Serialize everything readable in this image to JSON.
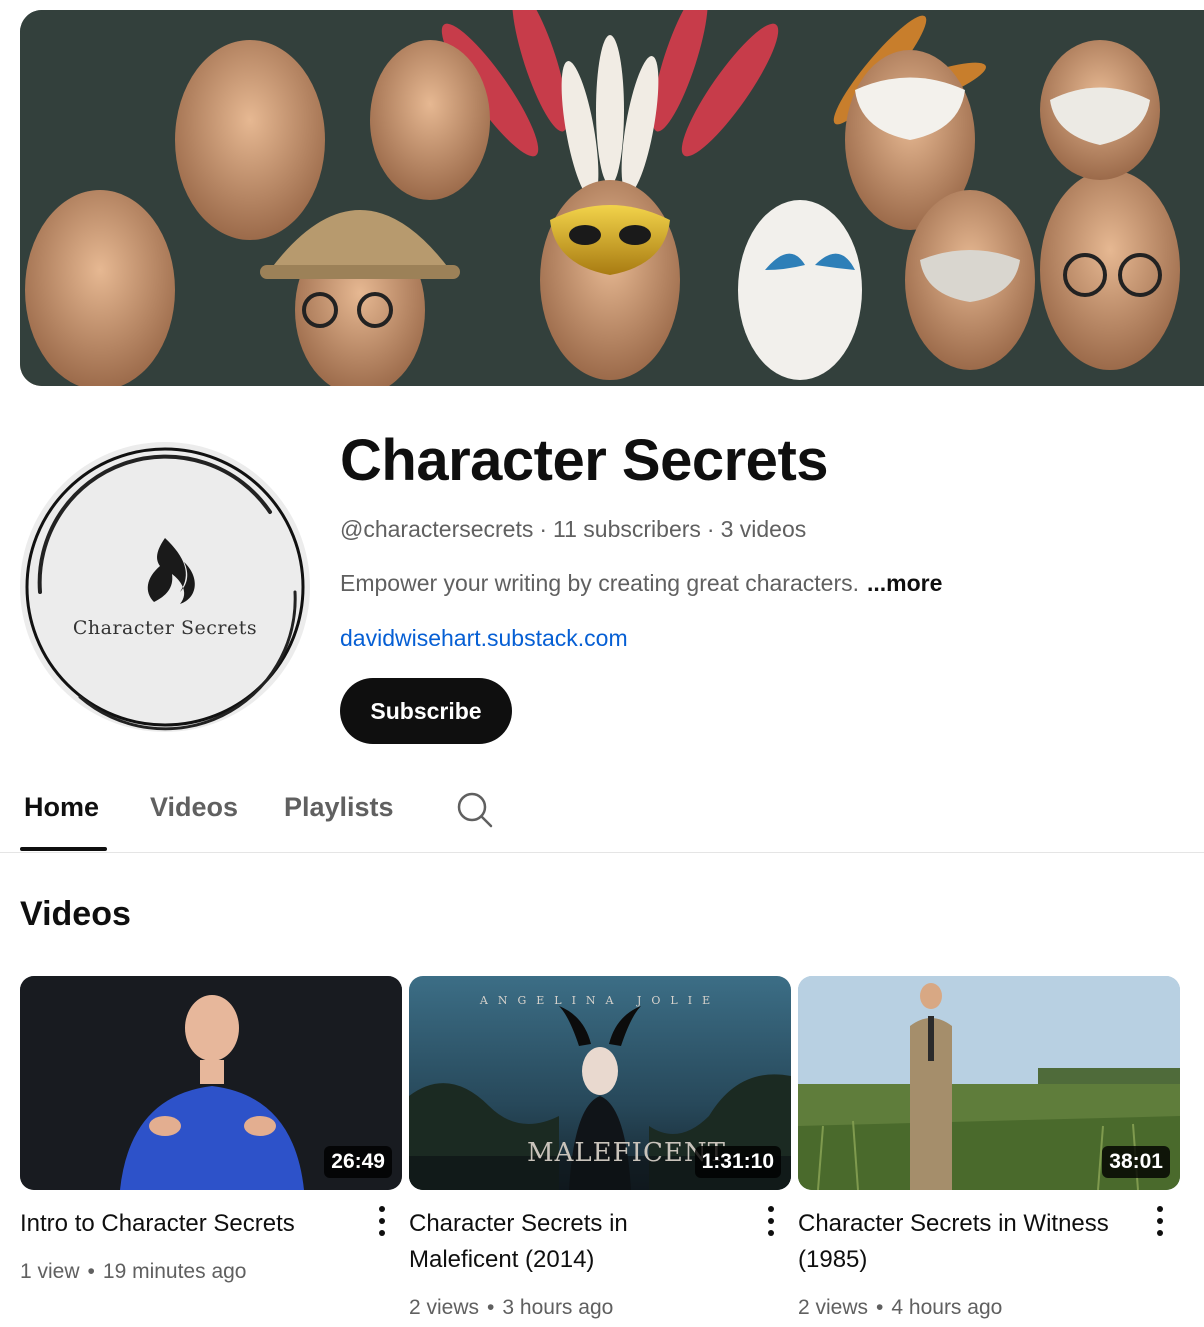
{
  "channel": {
    "name": "Character Secrets",
    "handle": "@charactersecrets",
    "subscribers": "11 subscribers",
    "videos_count": "3 videos",
    "description": "Empower your writing by creating great characters.",
    "more_label": "...more",
    "link": "davidwisehart.substack.com",
    "subscribe_label": "Subscribe",
    "avatar_text": "Character Secrets"
  },
  "tabs": [
    {
      "label": "Home",
      "active": true
    },
    {
      "label": "Videos",
      "active": false
    },
    {
      "label": "Playlists",
      "active": false
    }
  ],
  "section": {
    "title": "Videos"
  },
  "videos": [
    {
      "title": "Intro to Character Secrets",
      "duration": "26:49",
      "views": "1 view",
      "age": "19 minutes ago"
    },
    {
      "title": "Character Secrets in Maleficent (2014)",
      "duration": "1:31:10",
      "views": "2 views",
      "age": "3 hours ago",
      "thumb_top_text": "ANGELINA JOLIE",
      "thumb_logo_text": "MALEFICENT"
    },
    {
      "title": "Character Secrets in Witness (1985)",
      "duration": "38:01",
      "views": "2 views",
      "age": "4 hours ago"
    }
  ],
  "colors": {
    "link": "#065fd4",
    "text": "#0f0f0f",
    "secondary": "#606060",
    "button": "#0f0f0f"
  },
  "icons": {
    "search": "search-icon",
    "more": "more-vert-icon",
    "avatar_logo": "flame-icon"
  }
}
